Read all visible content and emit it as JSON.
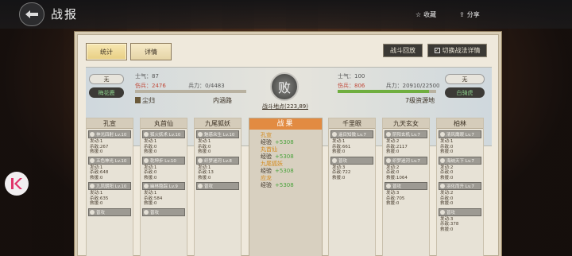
{
  "header": {
    "title": "战报",
    "favorite_label": "收藏",
    "share_label": "分享"
  },
  "tabs": [
    {
      "label": "统计"
    },
    {
      "label": "详情"
    }
  ],
  "actions": {
    "battle_map": "战斗回放",
    "toggle_detail": "切换战法详情"
  },
  "left": {
    "morale_label": "士气：",
    "morale": "87",
    "hurt_label": "伤兵：",
    "hurt": "2476",
    "troops_label": "兵力：",
    "troops": "0/4483",
    "badge": "无",
    "commander": "梅花鹿",
    "player_tag": "尘归",
    "location": "内涵路",
    "troops_fraction": 0.0
  },
  "right": {
    "morale_label": "士气：",
    "morale": "100",
    "hurt_label": "伤兵：",
    "hurt": "806",
    "troops_label": "兵力：",
    "troops": "20910/22500",
    "badge": "无",
    "commander": "白骑虎",
    "location": "7级资源地",
    "troops_fraction": 0.93
  },
  "result": {
    "icon": "败",
    "coords": "战斗地点(223,89)"
  },
  "left_columns": [
    {
      "name": "孔宣",
      "skills": [
        "神光四射 Lv.10",
        "五色神光 Lv.10",
        "九凤朝阳 Lv.10",
        "普攻"
      ],
      "stats": [
        [
          "发动:1",
          "杀敌:267",
          "救援:0"
        ],
        [
          "发动:1",
          "杀敌:648",
          "救援:0"
        ],
        [
          "发动:1",
          "杀敌:635",
          "救援:0"
        ]
      ]
    },
    {
      "name": "丸首仙",
      "skills": [
        "狐火妖术 Lv.10",
        "乾坤步 Lv.10",
        "幽林隐踪 Lv.9",
        "普攻"
      ],
      "stats": [
        [
          "发动:1",
          "杀敌:0",
          "救援:0"
        ],
        [
          "发动:1",
          "杀敌:0",
          "救援:0"
        ],
        [
          "发动:1",
          "杀敌:584",
          "救援:0"
        ]
      ]
    },
    {
      "name": "九尾狐妖",
      "skills": [
        "魅惑众生 Lv.10",
        "织梦迷河 Lv.8",
        "普攻"
      ],
      "stats": [
        [
          "发动:1",
          "杀敌:0",
          "救援:0"
        ],
        [
          "发动:1",
          "杀敌:13",
          "救援:0"
        ]
      ]
    }
  ],
  "center": {
    "title": "战果",
    "entries": [
      {
        "name": "孔宣",
        "exp_label": "经验",
        "gain": "+5308"
      },
      {
        "name": "丸首仙",
        "exp_label": "经验",
        "gain": "+5308"
      },
      {
        "name": "九尾狐妖",
        "exp_label": "经验",
        "gain": "+5308"
      },
      {
        "name": "应龙",
        "exp_label": "经验",
        "gain": "+5308"
      }
    ]
  },
  "right_columns": [
    {
      "name": "千里眼",
      "skills": [
        "遥目知微 Lv.7",
        "普攻"
      ],
      "stats": [
        [
          "发动:1",
          "杀敌:661",
          "救援:0"
        ],
        [
          "发动:3",
          "杀敌:722",
          "救援:0"
        ]
      ]
    },
    {
      "name": "九天玄女",
      "skills": [
        "阴阳玄机 Lv.7",
        "织梦迷河 Lv.7",
        "普攻"
      ],
      "stats": [
        [
          "发动:2",
          "杀敌:2117",
          "救援:0"
        ],
        [
          "发动:2",
          "杀敌:0",
          "救援:1064"
        ],
        [
          "发动:3",
          "杀敌:705",
          "救援:0"
        ]
      ]
    },
    {
      "name": "柏林",
      "skills": [
        "清风鹰眼 Lv.7",
        "海纳天下 Lv.7",
        "羽化而升 Lv.7",
        "普攻"
      ],
      "stats": [
        [
          "发动:1",
          "杀敌:0",
          "救援:0"
        ],
        [
          "发动:2",
          "杀敌:0",
          "救援:0"
        ],
        [
          "发动:2",
          "杀敌:0",
          "救援:0"
        ],
        [
          "发动:3",
          "杀敌:378",
          "救援:0"
        ]
      ]
    }
  ],
  "colors": {
    "accent_orange": "#e28b42",
    "exp_gain": "#4aa33c",
    "left_troops_bar": "#c04a3a",
    "right_troops_bar": "#6fae3f"
  }
}
